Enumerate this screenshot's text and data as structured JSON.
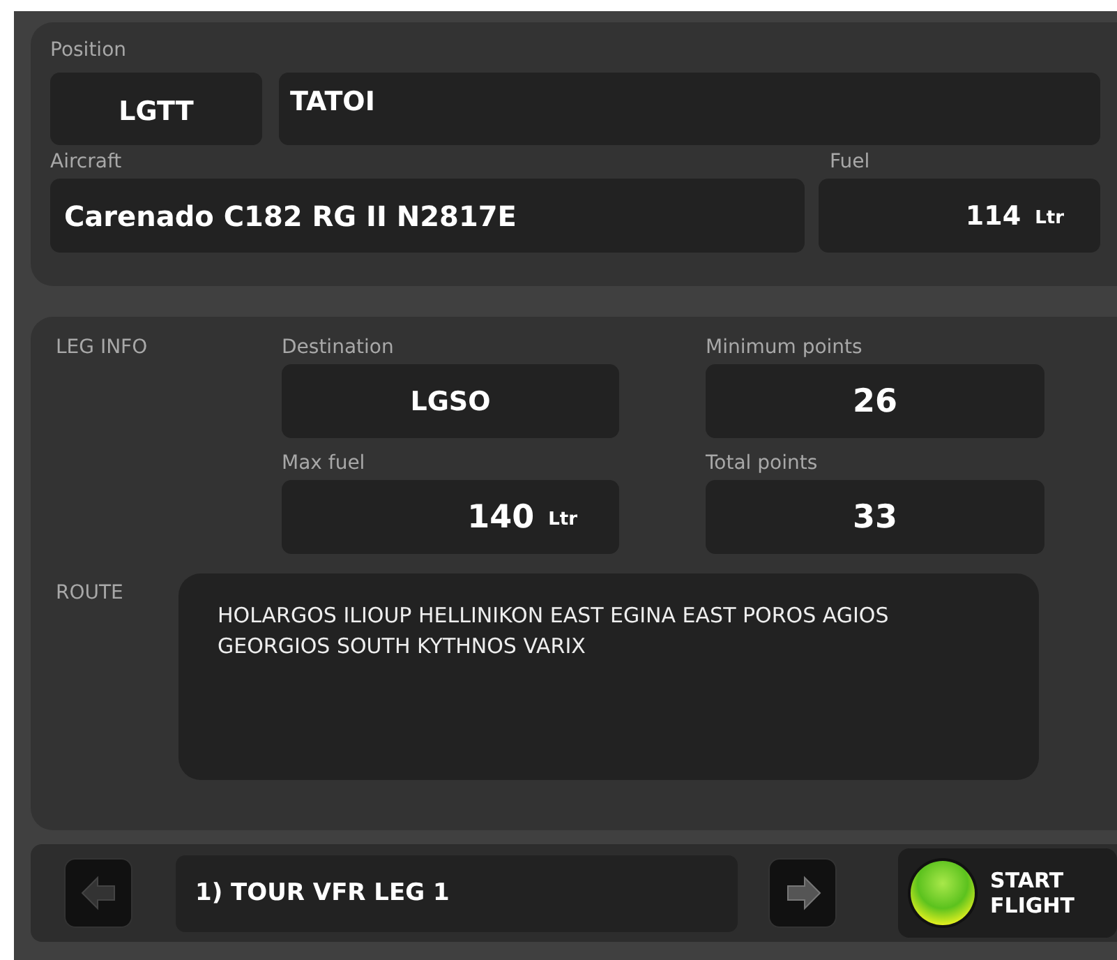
{
  "position": {
    "label": "Position",
    "code": "LGTT",
    "name": "TATOI"
  },
  "aircraft": {
    "label": "Aircraft",
    "value": "Carenado C182 RG II N2817E"
  },
  "fuel": {
    "label": "Fuel",
    "value": "114",
    "unit": "Ltr"
  },
  "leg_info": {
    "title": "LEG INFO",
    "destination": {
      "label": "Destination",
      "value": "LGSO"
    },
    "minimum_points": {
      "label": "Minimum points",
      "value": "26"
    },
    "max_fuel": {
      "label": "Max fuel",
      "value": "140",
      "unit": "Ltr"
    },
    "total_points": {
      "label": "Total points",
      "value": "33"
    }
  },
  "route": {
    "label": "ROUTE",
    "value": "HOLARGOS ILIOUP HELLINIKON EAST EGINA EAST POROS AGIOS GEORGIOS SOUTH KYTHNOS VARIX"
  },
  "footer": {
    "prev_disabled": true,
    "next_disabled": false,
    "leg": "1) TOUR VFR LEG 1",
    "start_label": "START FLIGHT"
  }
}
